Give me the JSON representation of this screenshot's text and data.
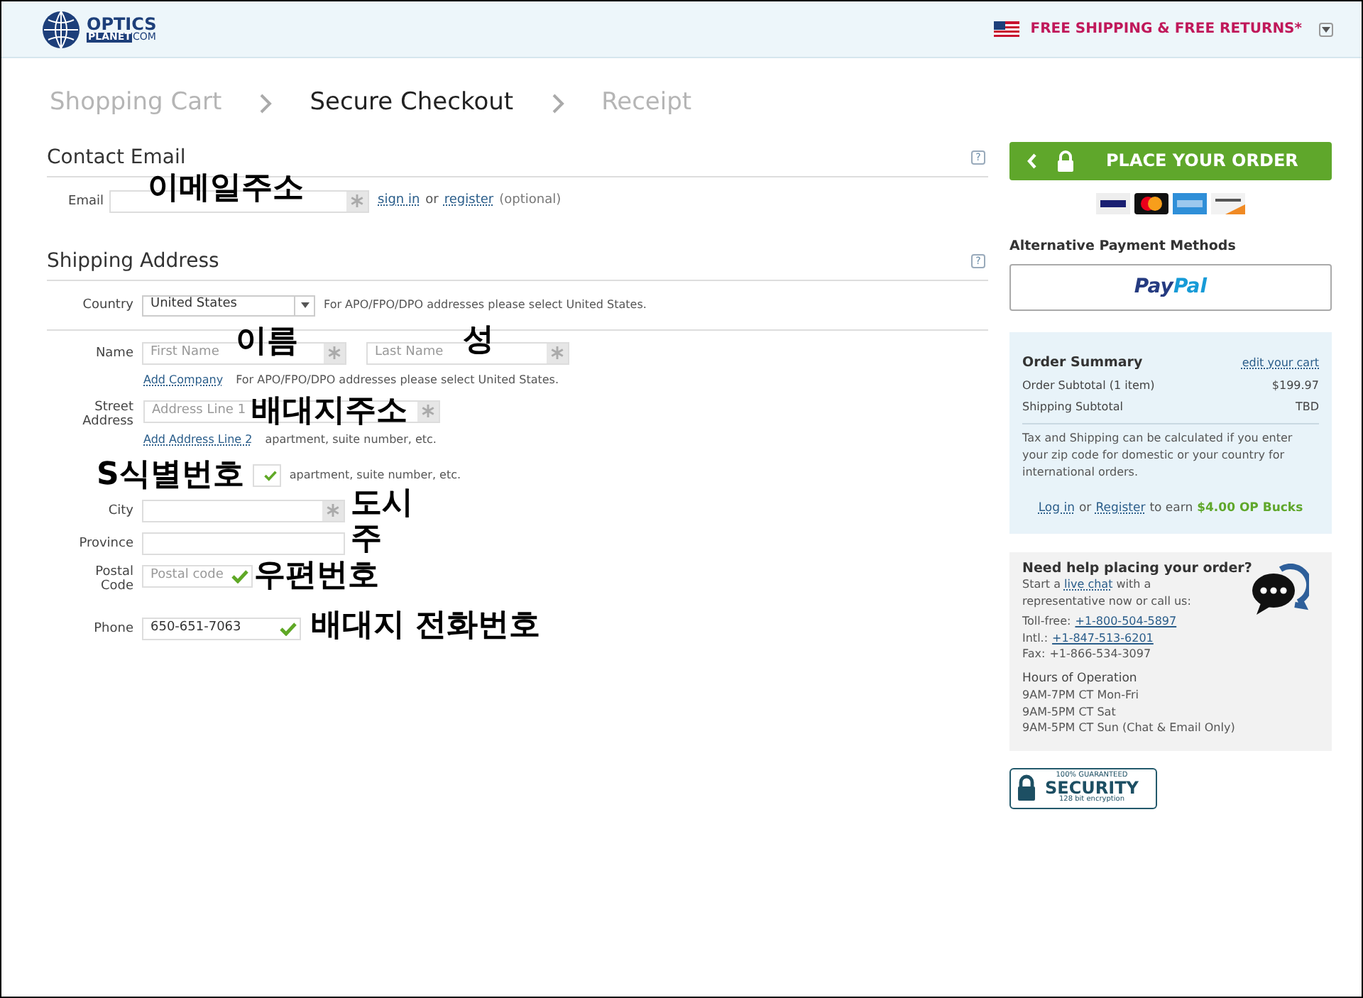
{
  "header": {
    "logo": {
      "top": "OPTICS",
      "bottom": "PLANET",
      "suffix": "COM"
    },
    "promo": "FREE SHIPPING & FREE RETURNS*"
  },
  "steps": [
    {
      "label": "Shopping Cart",
      "selected": false
    },
    {
      "label": "Secure Checkout",
      "selected": true
    },
    {
      "label": "Receipt",
      "selected": false
    }
  ],
  "contact": {
    "title": "Contact Email",
    "help": "?",
    "email": {
      "label": "Email",
      "required": true
    },
    "sign_in": "sign in",
    "or": "or",
    "register": "register",
    "optional": "(optional)"
  },
  "shipping": {
    "title": "Shipping Address",
    "help": "?",
    "country": {
      "label": "Country",
      "value": "United States",
      "note": "For APO/FPO/DPO addresses please select United States."
    },
    "first_name": {
      "label": "Name",
      "placeholder": "First Name",
      "required": true
    },
    "last_name": {
      "placeholder": "Last Name",
      "required": true
    },
    "add_company": "Add Company",
    "company_note": "For APO/FPO/DPO addresses please select United States.",
    "street": {
      "label": "Street Address",
      "placeholder": "Address Line 1",
      "required": true
    },
    "add_line2": "Add Address Line 2",
    "line2_note": "apartment, suite number, etc.",
    "line2": {
      "valid": true,
      "note": "apartment, suite number, etc."
    },
    "city": {
      "label": "City",
      "required": true
    },
    "province": {
      "label": "Province"
    },
    "postal": {
      "label": "Postal Code",
      "placeholder": "Postal code",
      "valid": true
    },
    "phone": {
      "label": "Phone",
      "value": "650-651-7063",
      "valid": true
    }
  },
  "annotations": [
    {
      "text": "이메일주소"
    },
    {
      "text": "이름"
    },
    {
      "text": "성"
    },
    {
      "text": "배대지주소"
    },
    {
      "text": "S식별번호"
    },
    {
      "text": "도시"
    },
    {
      "text": "주"
    },
    {
      "text": "우편번호"
    },
    {
      "text": "배대지 전화번호"
    }
  ],
  "sidebar": {
    "place_order": "PLACE YOUR ORDER",
    "alt_title": "Alternative Payment Methods",
    "paypal": {
      "pay": "Pay",
      "pal": "Pal"
    },
    "summary": {
      "title": "Order Summary",
      "edit": "edit your cart",
      "rows": [
        {
          "label": "Order Subtotal (1 item)",
          "value": "$199.97"
        },
        {
          "label": "Shipping Subtotal",
          "value": "TBD"
        }
      ],
      "note": "Tax and Shipping can be calculated if you enter your zip code for domestic or your country for international orders.",
      "login": "Log in",
      "or": "or",
      "register": "Register",
      "earn": "to earn",
      "bucks": "$4.00 OP Bucks"
    },
    "help": {
      "title": "Need help placing your order?",
      "start": "Start a",
      "live_chat": "live chat",
      "rest": "with a representative now or call us:",
      "phones": [
        {
          "label": "Toll-free:",
          "number": "+1-800-504-5897",
          "link": true
        },
        {
          "label": "Intl.:",
          "number": "+1-847-513-6201",
          "link": true
        },
        {
          "label": "Fax:",
          "number": "+1-866-534-3097",
          "link": false
        }
      ],
      "hours_title": "Hours of Operation",
      "hours": [
        "9AM-7PM CT Mon-Fri",
        "9AM-5PM CT Sat",
        "9AM-5PM CT Sun (Chat & Email Only)"
      ]
    },
    "security": {
      "top": "100% GUARANTEED",
      "main": "SECURITY",
      "bottom": "128 bit encryption"
    }
  }
}
